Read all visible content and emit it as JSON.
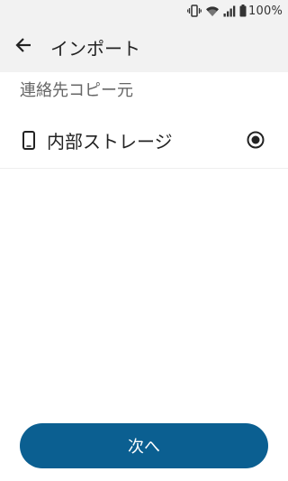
{
  "status_bar": {
    "icons": [
      "vibrate-icon",
      "wifi-icon",
      "signal-icon",
      "battery-icon"
    ],
    "battery_text": "100%"
  },
  "app_bar": {
    "back_icon": "back-arrow-icon",
    "title": "インポート"
  },
  "section": {
    "header": "連絡先コピー元"
  },
  "options": [
    {
      "icon": "phone-icon",
      "label": "内部ストレージ",
      "selected": true
    }
  ],
  "footer": {
    "next_label": "次へ"
  },
  "colors": {
    "accent": "#0b5f91",
    "app_bar_bg": "#f2f2f2",
    "text_primary": "#222222",
    "text_secondary": "#666666"
  }
}
